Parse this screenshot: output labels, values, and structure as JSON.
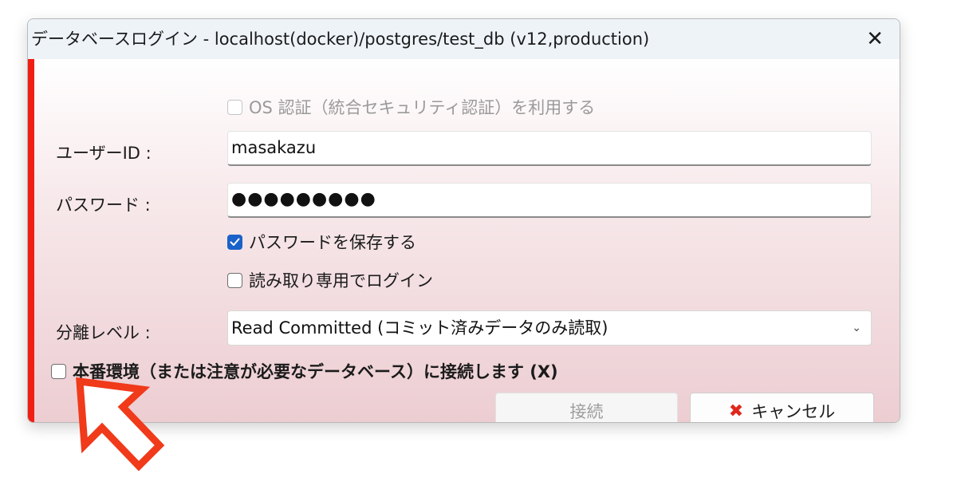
{
  "window": {
    "title": "データベースログイン - localhost(docker)/postgres/test_db (v12,production)",
    "close_glyph": "✕"
  },
  "os_auth": {
    "label": "OS 認証（統合セキュリティ認証）を利用する",
    "checked": false,
    "enabled": false
  },
  "user_id": {
    "label": "ユーザーID :",
    "value": "masakazu"
  },
  "password": {
    "label": "パスワード :",
    "value": "●●●●●●●●●"
  },
  "save_password": {
    "label": "パスワードを保存する",
    "checked": true
  },
  "read_only": {
    "label": "読み取り専用でログイン",
    "checked": false
  },
  "isolation": {
    "label": "分離レベル :",
    "selected": "Read Committed (コミット済みデータのみ読取)",
    "chevron": "⌄"
  },
  "production": {
    "label": "本番環境（または注意が必要なデータベース）に接続します (X)",
    "checked": false
  },
  "buttons": {
    "connect": "接続",
    "cancel": "キャンセル",
    "cancel_icon": "✖"
  },
  "colors": {
    "accent_red": "#f01e14",
    "checkbox_blue": "#1a62c9",
    "arrow_red": "#f03a1a"
  },
  "icons": [
    "close-icon",
    "check-icon",
    "chevron-down-icon",
    "cancel-x-icon",
    "pointer-arrow-icon"
  ]
}
